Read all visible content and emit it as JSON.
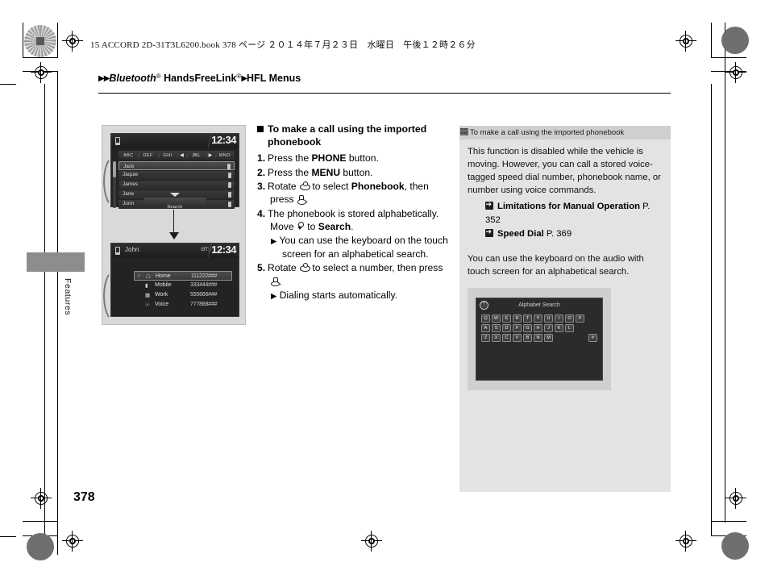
{
  "bookinfo": "15 ACCORD 2D-31T3L6200.book   378 ページ   ２０１４年７月２３日　水曜日　午後１２時２６分",
  "breadcrumb": {
    "tri1": "▶",
    "tri2": "▶",
    "bluetooth": "Bluetooth",
    "reg1": "®",
    "handsfreelink": " HandsFreeLink",
    "reg2": "®",
    "tri3": "▶",
    "section": "HFL Menus"
  },
  "side_tab_label": "Features",
  "page_number": "378",
  "illustration": {
    "top_device": {
      "status_name": "",
      "clock": "12:34",
      "tabs": [
        {
          "label": "ABC",
          "selected": false
        },
        {
          "label": "DEF",
          "selected": false
        },
        {
          "label": "GHI",
          "selected": false
        },
        {
          "label": "JKL",
          "selected": true
        },
        {
          "label": "MNO",
          "selected": false
        }
      ],
      "left_arrow": "◀",
      "right_arrow": "▶",
      "entries": [
        {
          "name": "Jack",
          "selected": true
        },
        {
          "name": "Jaquie",
          "selected": false
        },
        {
          "name": "James",
          "selected": false
        },
        {
          "name": "Jane",
          "selected": false
        },
        {
          "name": "Jonn",
          "selected": false
        }
      ],
      "search_label": "Search"
    },
    "bottom_device": {
      "status_name": "John",
      "signal": "ΘΤ░",
      "clock": "12:34",
      "numbers": [
        {
          "type": "Home",
          "number": "111222###",
          "selected": true
        },
        {
          "type": "Mobile",
          "number": "333444###",
          "selected": false
        },
        {
          "type": "Work",
          "number": "555666###",
          "selected": false
        },
        {
          "type": "Voice",
          "number": "777888###",
          "selected": false
        }
      ]
    }
  },
  "instructions": {
    "heading": "To make a call using the imported phonebook",
    "steps": [
      {
        "num": "1.",
        "pre": "Press the ",
        "bold": "PHONE",
        "post": " button."
      },
      {
        "num": "2.",
        "pre": "Press the ",
        "bold": "MENU",
        "post": " button."
      },
      {
        "num": "3.",
        "pre": "Rotate ",
        "bold": "Phonebook",
        "mid": " to select ",
        "post": ", then press "
      },
      {
        "num": "4.",
        "pre": "The phonebook is stored alphabetically. Move ",
        "mid": " to ",
        "bold": "Search",
        "post": "."
      },
      {
        "num": "5.",
        "pre": "Rotate ",
        "mid": " to select a number, then press ",
        "post": ""
      }
    ],
    "bullet4": "You can use the keyboard on the touch screen for an alphabetical search.",
    "bullet5": "Dialing starts automatically.",
    "bullet_marker": "▶"
  },
  "sidebar": {
    "header": "To make a call using the imported phonebook",
    "paragraph1": "This function is disabled while the vehicle is moving. However, you can call a stored voice-tagged speed dial number, phonebook name, or number using voice commands.",
    "refs": [
      {
        "title": "Limitations for Manual Operation",
        "page": "P. 352"
      },
      {
        "title": "Speed Dial",
        "page": "P. 369"
      }
    ],
    "paragraph2": "You can use the keyboard on the audio with touch screen for an alphabetical search.",
    "keyboard": {
      "title": "Alphabet Search",
      "back_icon": "Ⓣ",
      "row1": [
        "Q",
        "W",
        "E",
        "R",
        "T",
        "Y",
        "U",
        "I",
        "O",
        "P"
      ],
      "row2": [
        "A",
        "S",
        "D",
        "F",
        "G",
        "H",
        "J",
        "K",
        "L"
      ],
      "row3": [
        "Z",
        "X",
        "C",
        "V",
        "B",
        "N",
        "M"
      ],
      "hash": "#"
    }
  }
}
